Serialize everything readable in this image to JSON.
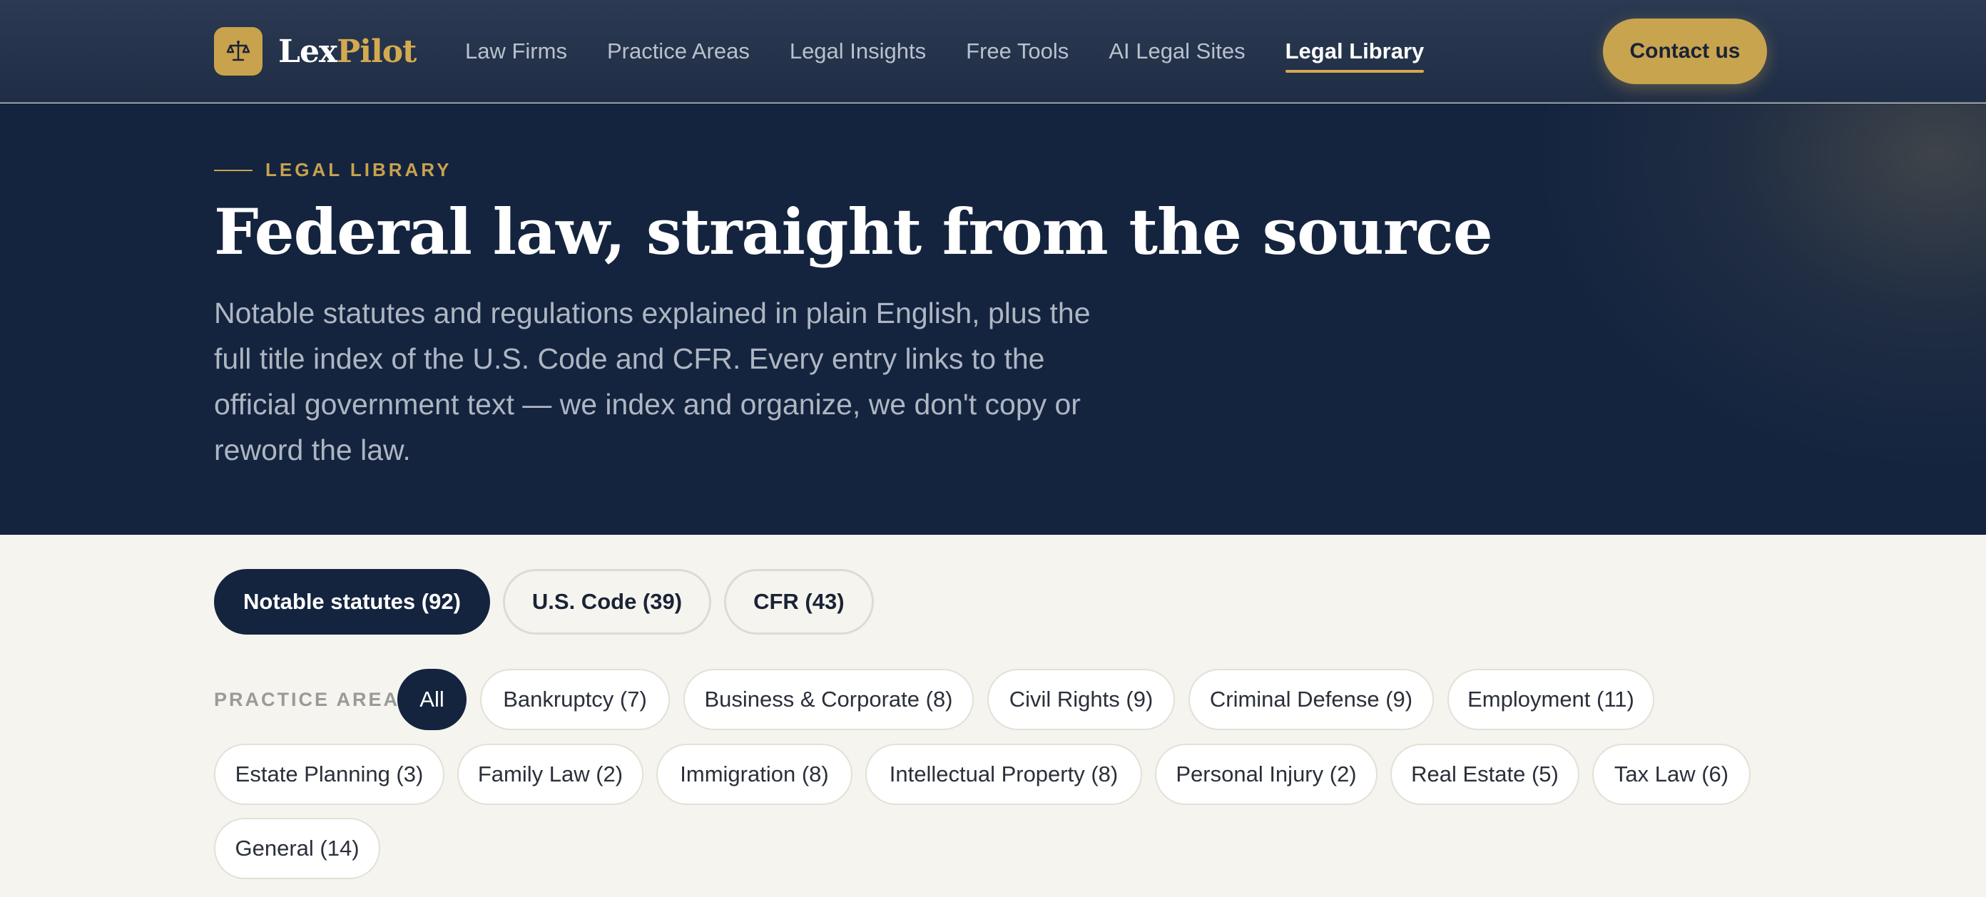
{
  "brand": {
    "name_part1": "Lex",
    "name_part2": "Pilot",
    "icon": "scale-icon"
  },
  "nav": {
    "items": [
      {
        "label": "Law Firms",
        "active": false
      },
      {
        "label": "Practice Areas",
        "active": false
      },
      {
        "label": "Legal Insights",
        "active": false
      },
      {
        "label": "Free Tools",
        "active": false
      },
      {
        "label": "AI Legal Sites",
        "active": false
      },
      {
        "label": "Legal Library",
        "active": true
      }
    ],
    "contact_label": "Contact us"
  },
  "hero": {
    "eyebrow": "LEGAL LIBRARY",
    "title": "Federal law, straight from the source",
    "description": "Notable statutes and regulations explained in plain English, plus the full title index of the U.S. Code and CFR. Every entry links to the official government text — we index and organize, we don't copy or reword the law."
  },
  "source_tabs": [
    {
      "label": "Notable statutes (92)",
      "active": true
    },
    {
      "label": "U.S. Code (39)",
      "active": false
    },
    {
      "label": "CFR (43)",
      "active": false
    }
  ],
  "practice_area": {
    "label": "PRACTICE AREA",
    "chips": [
      {
        "label": "All",
        "active": true
      },
      {
        "label": "Bankruptcy (7)",
        "active": false
      },
      {
        "label": "Business & Corporate (8)",
        "active": false
      },
      {
        "label": "Civil Rights (9)",
        "active": false
      },
      {
        "label": "Criminal Defense (9)",
        "active": false
      },
      {
        "label": "Employment (11)",
        "active": false
      },
      {
        "label": "Estate Planning (3)",
        "active": false
      },
      {
        "label": "Family Law (2)",
        "active": false
      },
      {
        "label": "Immigration (8)",
        "active": false
      },
      {
        "label": "Intellectual Property (8)",
        "active": false
      },
      {
        "label": "Personal Injury (2)",
        "active": false
      },
      {
        "label": "Real Estate (5)",
        "active": false
      },
      {
        "label": "Tax Law (6)",
        "active": false
      },
      {
        "label": "General (14)",
        "active": false
      }
    ]
  },
  "colors": {
    "navy": "#14243f",
    "gold": "#c8a24d",
    "background": "#f5f4ee"
  }
}
